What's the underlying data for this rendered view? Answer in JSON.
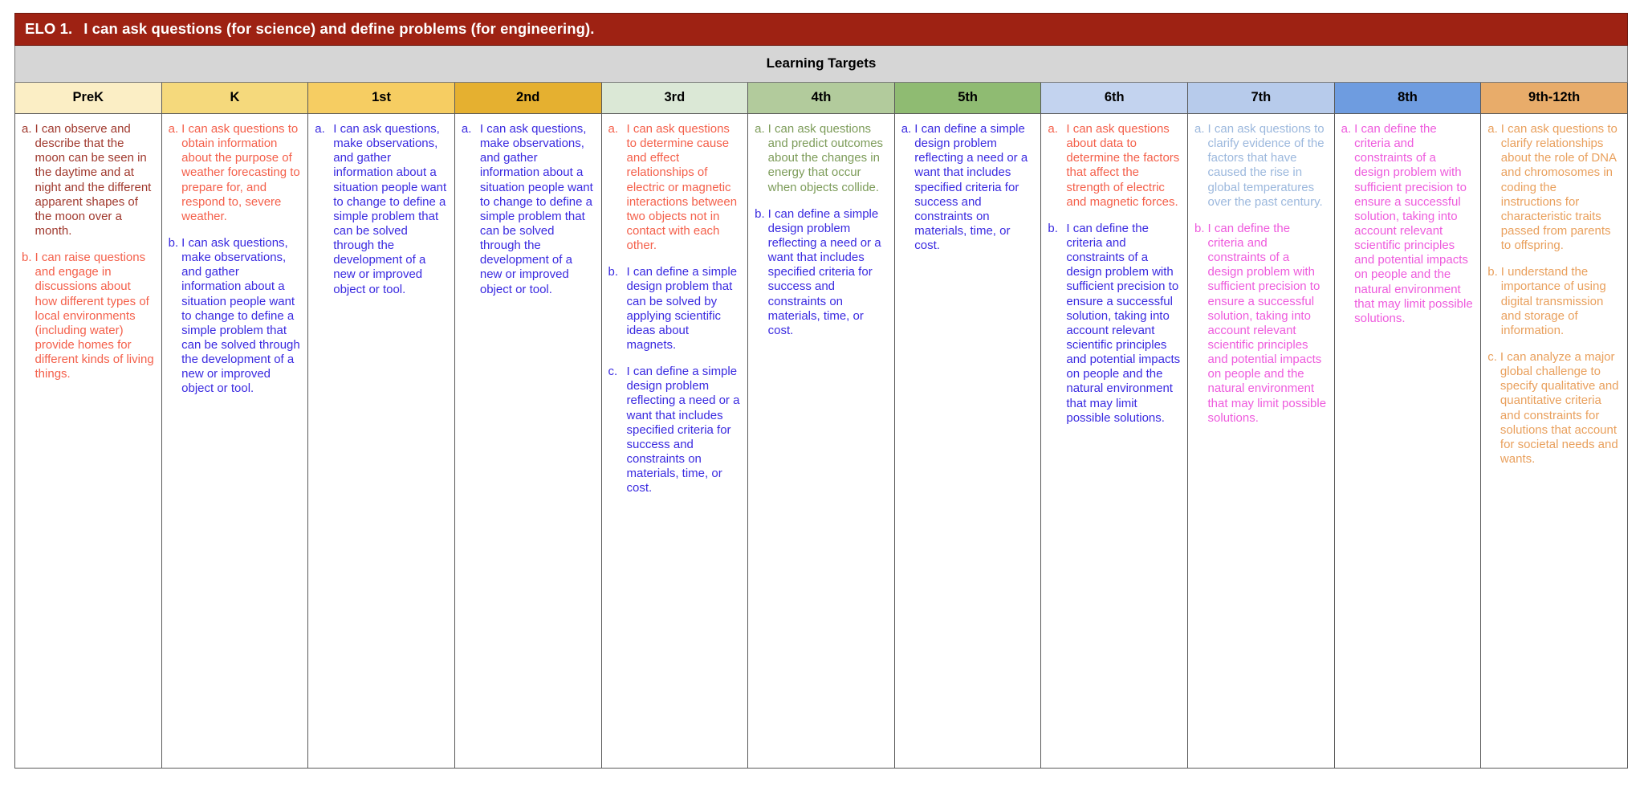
{
  "banner": {
    "number": "ELO 1.",
    "text": "I can ask questions (for science) and define problems (for engineering)."
  },
  "section_title": "Learning Targets",
  "colors": {
    "banner_bg": "#9e2213",
    "banner_fg": "#ffffff",
    "section_bg": "#d6d6d6",
    "text_darkred": "#a0392e",
    "text_red": "#f4604b",
    "text_blue": "#3a2ae0",
    "text_green": "#7d9c5a",
    "text_lightblue": "#9cb8dd",
    "text_magenta": "#ee5bdd",
    "text_orange": "#e9a05d"
  },
  "columns": [
    {
      "label": "PreK",
      "header_bg": "#fbeec5",
      "items": [
        {
          "marker": "a.",
          "color": "#a0392e",
          "text": "I can observe and describe that the moon can be seen in the daytime and at night and the different apparent shapes of the moon over a month."
        },
        {
          "marker": "b.",
          "color": "#f4604b",
          "text": "I can raise questions and engage in discussions about how different types of local environments (including water) provide homes for different kinds of living things."
        }
      ]
    },
    {
      "label": "K",
      "header_bg": "#f5d97c",
      "items": [
        {
          "marker": "a.",
          "color": "#f4604b",
          "text": "I can ask questions to obtain information about the purpose of weather forecasting to prepare for, and respond to, severe weather."
        },
        {
          "marker": "b.",
          "color": "#3a2ae0",
          "text": "I can ask questions, make observations, and gather information about a situation people want to change to define a simple problem that can be solved through the development of a new or improved object or tool."
        }
      ]
    },
    {
      "label": "1st",
      "header_bg": "#f6cd62",
      "items": [
        {
          "marker": "a.",
          "color": "#3a2ae0",
          "text": "I can ask questions, make observations, and gather information about a situation people want to change to define a simple problem that can be solved through the development of a new or improved object or tool."
        }
      ]
    },
    {
      "label": "2nd",
      "header_bg": "#e5b030",
      "items": [
        {
          "marker": "a.",
          "color": "#3a2ae0",
          "text": "I can ask questions, make observations, and gather information about a situation people want to change to define a simple problem that can be solved through the development of a new or improved object or tool."
        }
      ]
    },
    {
      "label": "3rd",
      "header_bg": "#dbe8d6",
      "items": [
        {
          "marker": "a.",
          "color": "#f4604b",
          "text": "I can ask questions to determine cause and effect relationships of electric or magnetic interactions between two objects not in contact with each other."
        },
        {
          "marker": "b.",
          "color": "#3a2ae0",
          "text": "I can define a simple design problem that can be solved by applying scientific ideas about magnets."
        },
        {
          "marker": "c.",
          "color": "#3a2ae0",
          "text": "I can define a simple design problem reflecting a need or a want that includes specified criteria for success and constraints on materials, time, or cost."
        }
      ]
    },
    {
      "label": "4th",
      "header_bg": "#b2cb9c",
      "items": [
        {
          "marker": "a.",
          "color": "#7d9c5a",
          "text": "I can ask questions and predict outcomes about the changes in energy that occur when objects collide."
        },
        {
          "marker": "b.",
          "color": "#3a2ae0",
          "text": "I can define a simple design problem reflecting a need or a want that includes specified criteria for success and constraints on materials, time, or cost."
        }
      ]
    },
    {
      "label": "5th",
      "header_bg": "#8fbb72",
      "items": [
        {
          "marker": "a.",
          "color": "#3a2ae0",
          "text": "I can define a simple design problem reflecting a need or a want that includes specified criteria for success and constraints on materials, time, or cost."
        }
      ]
    },
    {
      "label": "6th",
      "header_bg": "#c3d3ef",
      "items": [
        {
          "marker": "a.",
          "color": "#f4604b",
          "text": "I can ask questions about data to determine the factors that affect the strength of electric and magnetic forces."
        },
        {
          "marker": "b.",
          "color": "#3a2ae0",
          "text": "I can define the criteria and constraints of a design problem with sufficient precision to ensure a successful solution, taking into account relevant scientific principles and potential impacts on people and the natural environment that may limit possible solutions."
        }
      ]
    },
    {
      "label": "7th",
      "header_bg": "#b7cbeb",
      "items": [
        {
          "marker": "a.",
          "color": "#9cb8dd",
          "text": "I can ask questions to clarify evidence of the factors that have caused the rise in global temperatures over the past century."
        },
        {
          "marker": "b.",
          "color": "#ee5bdd",
          "text": "I can define the criteria and constraints of a design problem with sufficient precision to ensure a successful solution, taking into account relevant scientific principles and potential impacts on people and the natural environment that may limit possible solutions."
        }
      ]
    },
    {
      "label": "8th",
      "header_bg": "#6e9ce0",
      "items": [
        {
          "marker": "a.",
          "color": "#ee5bdd",
          "text": "I can define the criteria and constraints of a design problem with sufficient precision to ensure a successful solution, taking into account relevant scientific principles and potential impacts on people and the natural environment that may limit possible solutions."
        }
      ]
    },
    {
      "label": "9th-12th",
      "header_bg": "#e8ac6a",
      "items": [
        {
          "marker": "a.",
          "color": "#e9a05d",
          "text": "I can ask questions to clarify relationships about the role of DNA and chromosomes in coding the instructions for characteristic traits passed from parents to offspring."
        },
        {
          "marker": "b.",
          "color": "#e9a05d",
          "text": "I understand the importance of using digital transmission and storage of information."
        },
        {
          "marker": "c.",
          "color": "#e9a05d",
          "text": "I can analyze a major global challenge to specify qualitative and quantitative criteria and constraints for solutions that account for societal needs and wants."
        }
      ]
    }
  ]
}
